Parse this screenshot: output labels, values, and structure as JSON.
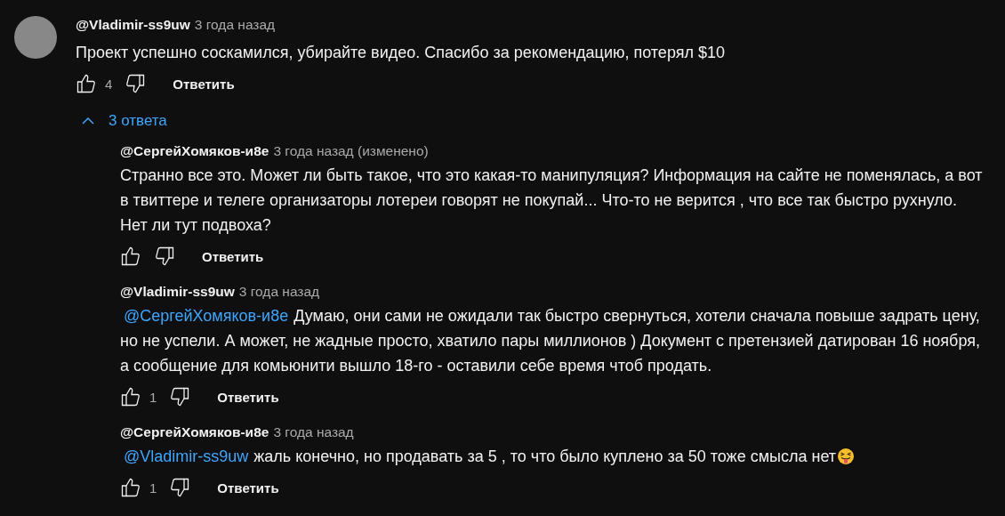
{
  "comment": {
    "author": "@Vladimir-ss9uw",
    "time": "3 года назад",
    "text": "Проект успешно соскамился, убирайте видео. Спасибо за рекомендацию, потерял $10",
    "likes": "4",
    "reply_label": "Ответить"
  },
  "replies_toggle": {
    "label": "3 ответа",
    "expanded": true
  },
  "replies": [
    {
      "author": "@СергейХомяков-и8е",
      "time": "3 года назад (изменено)",
      "text": "Странно все это. Может ли быть такое, что это какая-то манипуляция? Информация на сайте не поменялась, а вот в твиттере и телеге организаторы лотереи говорят не покупай... Что-то не верится , что все так быстро рухнуло. Нет ли тут подвоха?",
      "reply_label": "Ответить"
    },
    {
      "author": "@Vladimir-ss9uw",
      "time": "3 года назад",
      "mention": "@СергейХомяков-и8е",
      "text": "Думаю, они сами не ожидали так быстро свернуться, хотели сначала повыше задрать цену, но не успели. А может, не жадные просто, хватило пары миллионов ) Документ с претензией датирован 16 ноября, а сообщение для комьюнити вышло 18-го - оставили себе время чтоб продать.",
      "likes": "1",
      "reply_label": "Ответить"
    },
    {
      "author": "@СергейХомяков-и8е",
      "time": "3 года назад",
      "mention": "@Vladimir-ss9uw",
      "text": "жаль конечно, но продавать за 5 , то что было куплено за 50 тоже смысла нет",
      "trailing_emoji": true,
      "likes": "1",
      "reply_label": "Ответить"
    }
  ]
}
